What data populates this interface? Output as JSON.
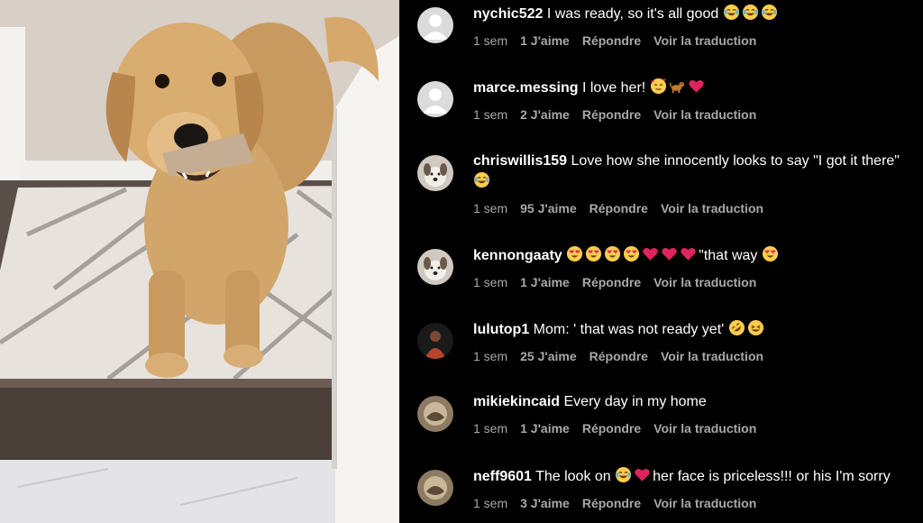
{
  "comments": [
    {
      "username": "nychic522",
      "text": "I was ready, so it's all good",
      "emoji_after": [
        "laughing-tears-icon",
        "laughing-tears-icon",
        "laughing-tears-icon"
      ],
      "time": "1 sem",
      "likes": "1 J'aime",
      "reply": "Répondre",
      "translate": "Voir la traduction",
      "avatar": "default-avatar-icon"
    },
    {
      "username": "marce.messing",
      "text": "I love her!",
      "emoji_after": [
        "smiling-hearts-icon",
        "dog-icon",
        "red-heart-icon"
      ],
      "time": "1 sem",
      "likes": "2 J'aime",
      "reply": "Répondre",
      "translate": "Voir la traduction",
      "avatar": "default-avatar-icon"
    },
    {
      "username": "chriswillis159",
      "text": "Love how she innocently looks to say \"I got it there\"",
      "emoji_after": [
        "laughing-tears-icon"
      ],
      "time": "1 sem",
      "likes": "95 J'aime",
      "reply": "Répondre",
      "translate": "Voir la traduction",
      "avatar": "dog-photo-avatar"
    },
    {
      "username": "kennongaaty",
      "text": "\"that way",
      "emoji_before": [
        "heart-eyes-icon",
        "heart-eyes-icon",
        "heart-eyes-icon",
        "heart-eyes-icon",
        "red-heart-icon",
        "red-heart-icon",
        "red-heart-icon"
      ],
      "emoji_after": [
        "heart-eyes-icon"
      ],
      "time": "1 sem",
      "likes": "1 J'aime",
      "reply": "Répondre",
      "translate": "Voir la traduction",
      "avatar": "dog-photo-avatar"
    },
    {
      "username": "lulutop1",
      "text": "Mom: ' that was not ready yet'",
      "emoji_after": [
        "rofl-icon",
        "grinning-icon"
      ],
      "time": "1 sem",
      "likes": "25 J'aime",
      "reply": "Répondre",
      "translate": "Voir la traduction",
      "avatar": "person-photo-avatar"
    },
    {
      "username": "mikiekincaid",
      "text": "Every day in my home",
      "emoji_after": [],
      "time": "1 sem",
      "likes": "1 J'aime",
      "reply": "Répondre",
      "translate": "Voir la traduction",
      "avatar": "photo-avatar"
    },
    {
      "username": "neff9601",
      "text_before": "The look on",
      "emoji_mid": [
        "laughing-tears-icon",
        "red-heart-icon"
      ],
      "text": "her face is priceless!!! or his I'm sorry",
      "emoji_after": [],
      "time": "1 sem",
      "likes": "3 J'aime",
      "reply": "Répondre",
      "translate": "Voir la traduction",
      "avatar": "photo-avatar"
    }
  ],
  "colors": {
    "background": "#000000",
    "text": "#ffffff",
    "meta": "#a8a8a8",
    "heart": "#e0245e",
    "emoji_face": "#ffcc4d"
  }
}
